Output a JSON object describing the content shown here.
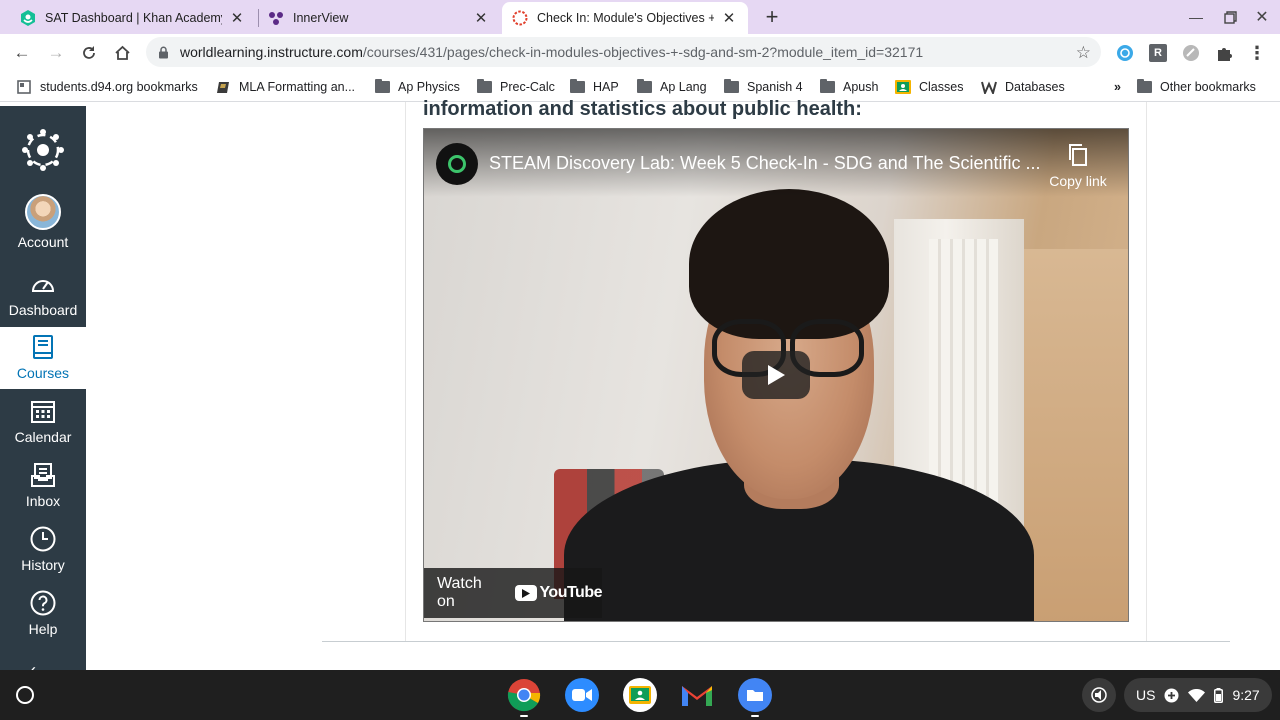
{
  "browser": {
    "tabs": [
      {
        "title": "SAT Dashboard | Khan Academy",
        "favicon": "khan-academy-icon",
        "active": false
      },
      {
        "title": "InnerView",
        "favicon": "innerview-icon",
        "active": false
      },
      {
        "title": "Check In: Module's Objectives + SDG and SM",
        "favicon": "canvas-icon",
        "active": true
      }
    ],
    "url_domain": "worldlearning.instructure.com",
    "url_path": "/courses/431/pages/check-in-modules-objectives-+-sdg-and-sm-2?module_item_id=32171",
    "extension_letter": "R",
    "bookmarks": [
      {
        "label": "students.d94.org bookmarks",
        "icon": "page-icon"
      },
      {
        "label": "MLA Formatting an...",
        "icon": "purdue-icon"
      },
      {
        "label": "Ap Physics",
        "icon": "folder-icon"
      },
      {
        "label": "Prec-Calc",
        "icon": "folder-icon"
      },
      {
        "label": "HAP",
        "icon": "folder-icon"
      },
      {
        "label": "Ap Lang",
        "icon": "folder-icon"
      },
      {
        "label": "Spanish 4",
        "icon": "folder-icon"
      },
      {
        "label": "Apush",
        "icon": "folder-icon"
      },
      {
        "label": "Classes",
        "icon": "classroom-icon"
      },
      {
        "label": "Databases",
        "icon": "weebly-icon"
      }
    ],
    "overflow_chevron": "»",
    "other_bookmarks": "Other bookmarks"
  },
  "canvas_nav": {
    "items": [
      {
        "label": "Account",
        "icon": "avatar",
        "active": false
      },
      {
        "label": "Dashboard",
        "icon": "dashboard-icon",
        "active": false
      },
      {
        "label": "Courses",
        "icon": "book-icon",
        "active": true
      },
      {
        "label": "Calendar",
        "icon": "calendar-icon",
        "active": false
      },
      {
        "label": "Inbox",
        "icon": "inbox-icon",
        "active": false
      },
      {
        "label": "History",
        "icon": "clock-icon",
        "active": false
      },
      {
        "label": "Help",
        "icon": "help-icon",
        "active": false
      }
    ]
  },
  "page": {
    "partial_text": "information and statistics about public health:"
  },
  "video": {
    "title": "STEAM Discovery Lab: Week 5 Check-In - SDG and The Scientific ...",
    "copy_link": "Copy link",
    "watch_on": "Watch on",
    "youtube": "YouTube"
  },
  "shelf": {
    "apps": [
      "chrome-icon",
      "zoom-icon",
      "google-classroom-icon",
      "gmail-icon",
      "files-icon"
    ],
    "locale": "US",
    "time": "9:27"
  }
}
